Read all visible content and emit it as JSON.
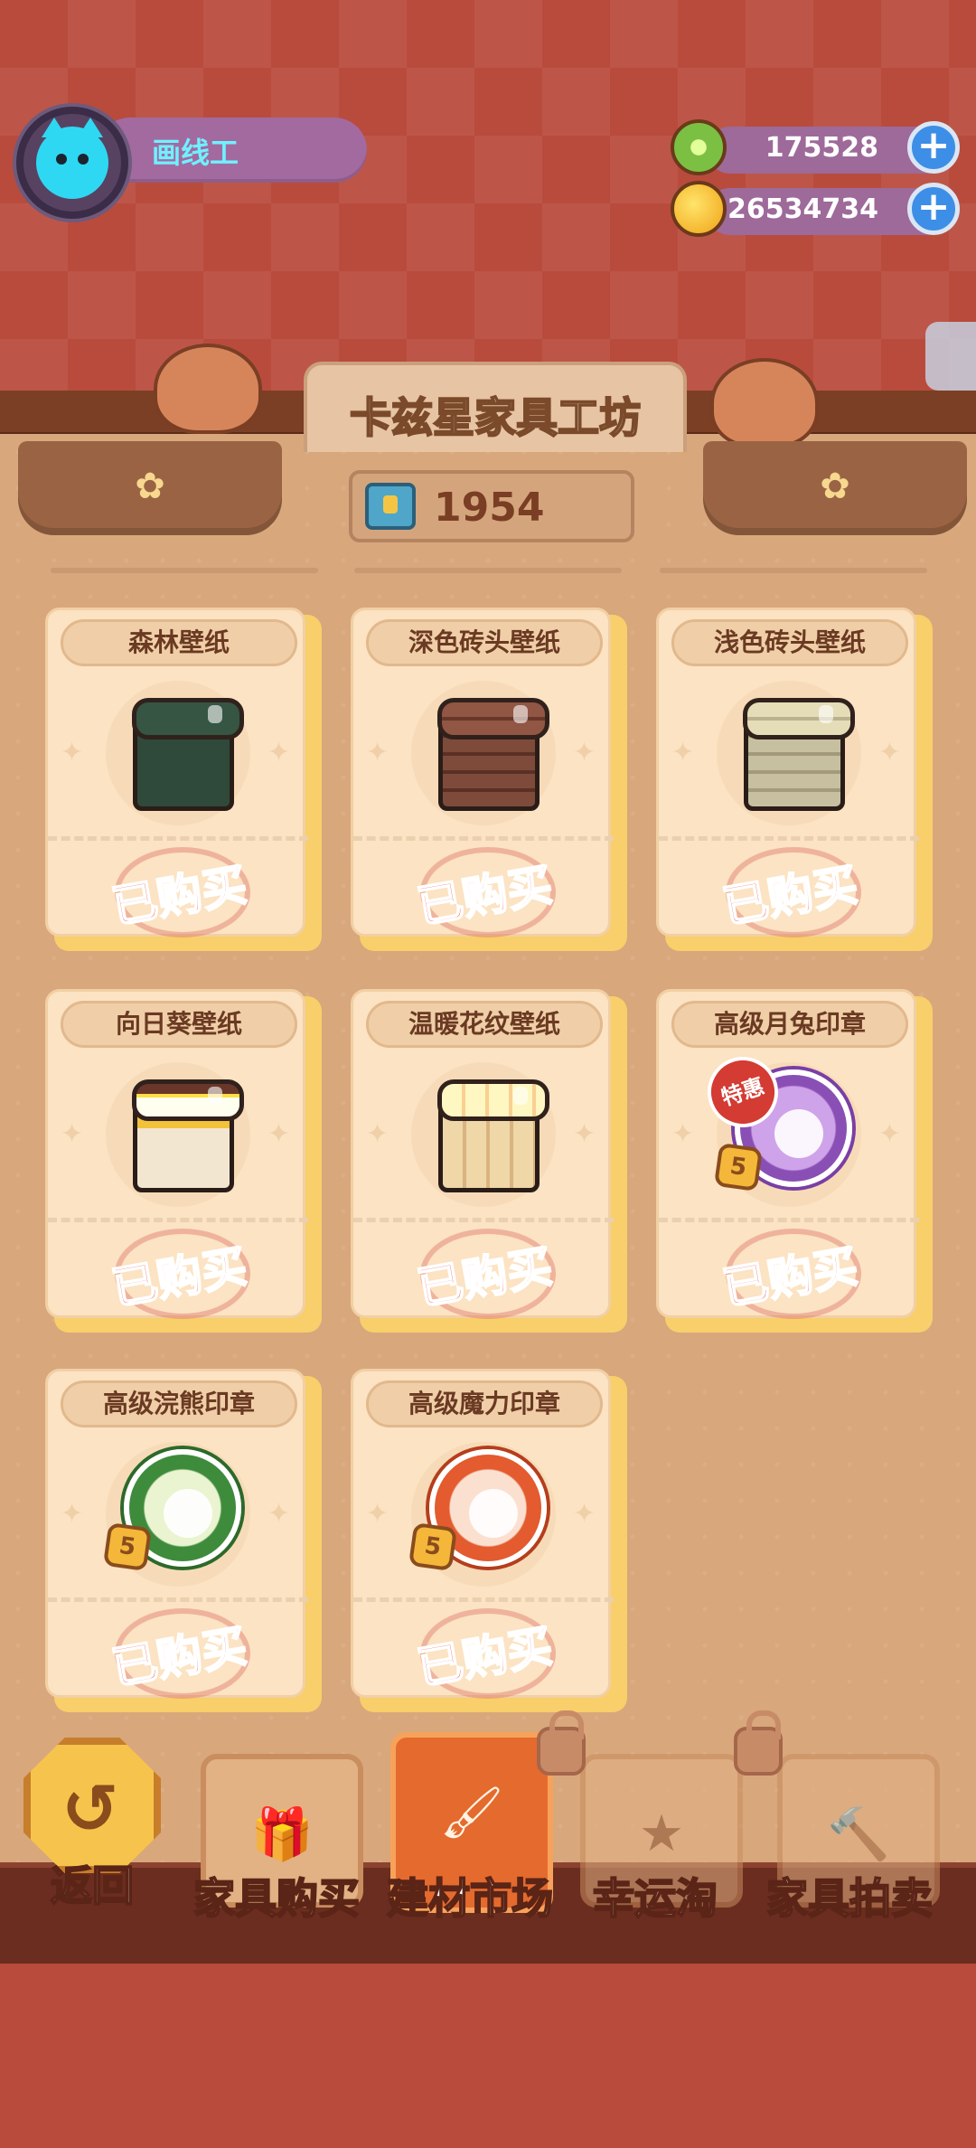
{
  "player": {
    "name": "画线工",
    "avatar_icon": "cat-avatar-icon"
  },
  "currencies": [
    {
      "name": "green-currency",
      "icon": "green-coin-icon",
      "amount": "175528"
    },
    {
      "name": "gold-currency",
      "icon": "gold-coin-icon",
      "amount": "26534734"
    }
  ],
  "shop": {
    "title": "卡兹星家具工坊",
    "ticket_count": "1954"
  },
  "items": [
    {
      "name": "森林壁纸",
      "status": "已购买",
      "icon": "forest-wallpaper-icon"
    },
    {
      "name": "深色砖头壁纸",
      "status": "已购买",
      "icon": "dark-brick-wallpaper-icon"
    },
    {
      "name": "浅色砖头壁纸",
      "status": "已购买",
      "icon": "light-brick-wallpaper-icon"
    },
    {
      "name": "向日葵壁纸",
      "status": "已购买",
      "icon": "sunflower-wallpaper-icon"
    },
    {
      "name": "温暖花纹壁纸",
      "status": "已购买",
      "icon": "warm-pattern-wallpaper-icon"
    },
    {
      "name": "高级月兔印章",
      "status": "已购买",
      "icon": "moon-rabbit-stamp-icon",
      "badge": "特惠",
      "level": "5"
    },
    {
      "name": "高级浣熊印章",
      "status": "已购买",
      "icon": "raccoon-stamp-icon",
      "level": "5"
    },
    {
      "name": "高级魔力印章",
      "status": "已购买",
      "icon": "magic-stamp-icon",
      "level": "5"
    }
  ],
  "nav": {
    "back": "返回",
    "tabs": [
      {
        "label": "家具购买",
        "icon": "gift-icon",
        "active": false,
        "locked": false
      },
      {
        "label": "建材市场",
        "icon": "paint-brush-icon",
        "active": true,
        "locked": false
      },
      {
        "label": "幸运淘",
        "icon": "star-icon",
        "active": false,
        "locked": true
      },
      {
        "label": "家具拍卖",
        "icon": "gavel-icon",
        "active": false,
        "locked": true
      }
    ]
  },
  "colors": {
    "background": "#b94b3d",
    "panel": "#d8a77c",
    "sold_stamp": "#e04a45",
    "active_tab": "#e56a2e"
  }
}
